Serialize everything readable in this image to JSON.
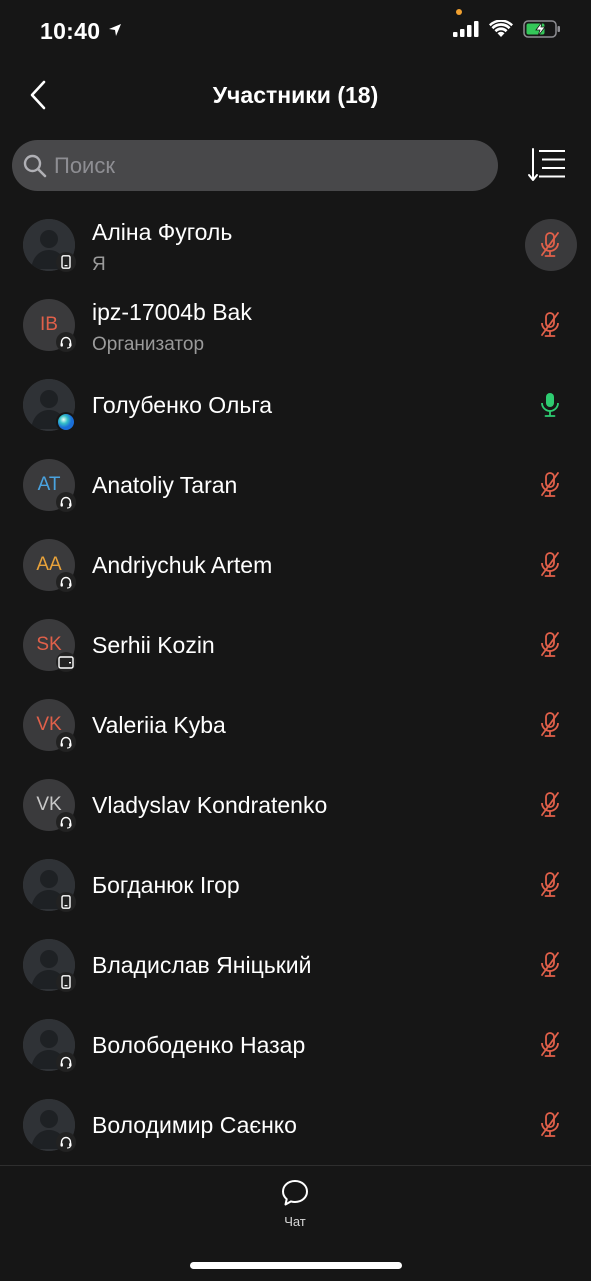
{
  "status": {
    "time": "10:40"
  },
  "header": {
    "title": "Участники (18)"
  },
  "search": {
    "placeholder": "Поиск",
    "value": ""
  },
  "colors": {
    "muted_mic": "#e0604a",
    "active_mic": "#2ecc71",
    "initials_red": "#e0604a",
    "initials_blue": "#4aa3e0",
    "initials_orange": "#e8a23a",
    "initials_gray": "#c8c8c8"
  },
  "participants": [
    {
      "name": "Аліна Фуголь",
      "sub": "Я",
      "avatar": "silhouette",
      "badge": "phone-icon",
      "mic": "muted",
      "mic_highlight": true
    },
    {
      "name": "ipz-17004b Bak",
      "sub": "Организатор",
      "initials": "IB",
      "initials_color": "#e0604a",
      "badge": "headset-icon",
      "mic": "muted"
    },
    {
      "name": "Голубенко Ольга",
      "avatar": "silhouette",
      "badge": "web-icon",
      "mic": "active"
    },
    {
      "name": "Anatoliy Taran",
      "initials": "AT",
      "initials_color": "#4aa3e0",
      "badge": "headset-icon",
      "mic": "muted"
    },
    {
      "name": "Andriychuk Artem",
      "initials": "AA",
      "initials_color": "#e8a23a",
      "badge": "headset-icon",
      "mic": "muted"
    },
    {
      "name": "Serhii Kozin",
      "initials": "SK",
      "initials_color": "#e0604a",
      "badge": "tablet-icon",
      "mic": "muted"
    },
    {
      "name": "Valeriia Kyba",
      "initials": "VK",
      "initials_color": "#e0604a",
      "badge": "headset-icon",
      "mic": "muted"
    },
    {
      "name": "Vladyslav Kondratenko",
      "initials": "VK",
      "initials_color": "#c8c8c8",
      "badge": "headset-icon",
      "mic": "muted"
    },
    {
      "name": "Богданюк Ігор",
      "avatar": "silhouette",
      "badge": "phone-icon",
      "mic": "muted"
    },
    {
      "name": "Владислав Яніцький",
      "avatar": "silhouette",
      "badge": "phone-icon",
      "mic": "muted"
    },
    {
      "name": "Волободенко Назар",
      "avatar": "silhouette",
      "badge": "headset-icon",
      "mic": "muted"
    },
    {
      "name": "Володимир Саєнко",
      "avatar": "silhouette",
      "badge": "headset-icon",
      "mic": "muted"
    }
  ],
  "tabbar": {
    "chat_label": "Чат"
  }
}
